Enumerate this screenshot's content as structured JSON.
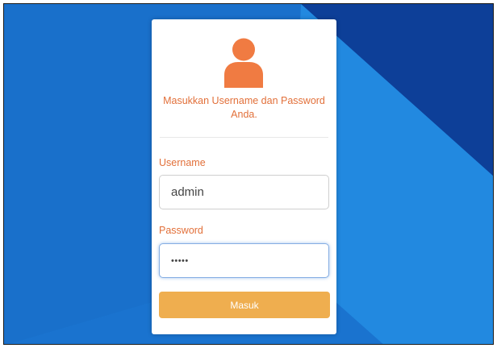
{
  "login": {
    "message": "Masukkan Username dan Password Anda.",
    "username_label": "Username",
    "username_value": "admin",
    "password_label": "Password",
    "password_value": "•••••",
    "submit_label": "Masuk"
  },
  "icons": {
    "avatar": "user-icon"
  },
  "colors": {
    "accent": "#e2703a",
    "button": "#efae4f",
    "background_dark": "#0d3f98",
    "background_light": "#2289e0"
  }
}
